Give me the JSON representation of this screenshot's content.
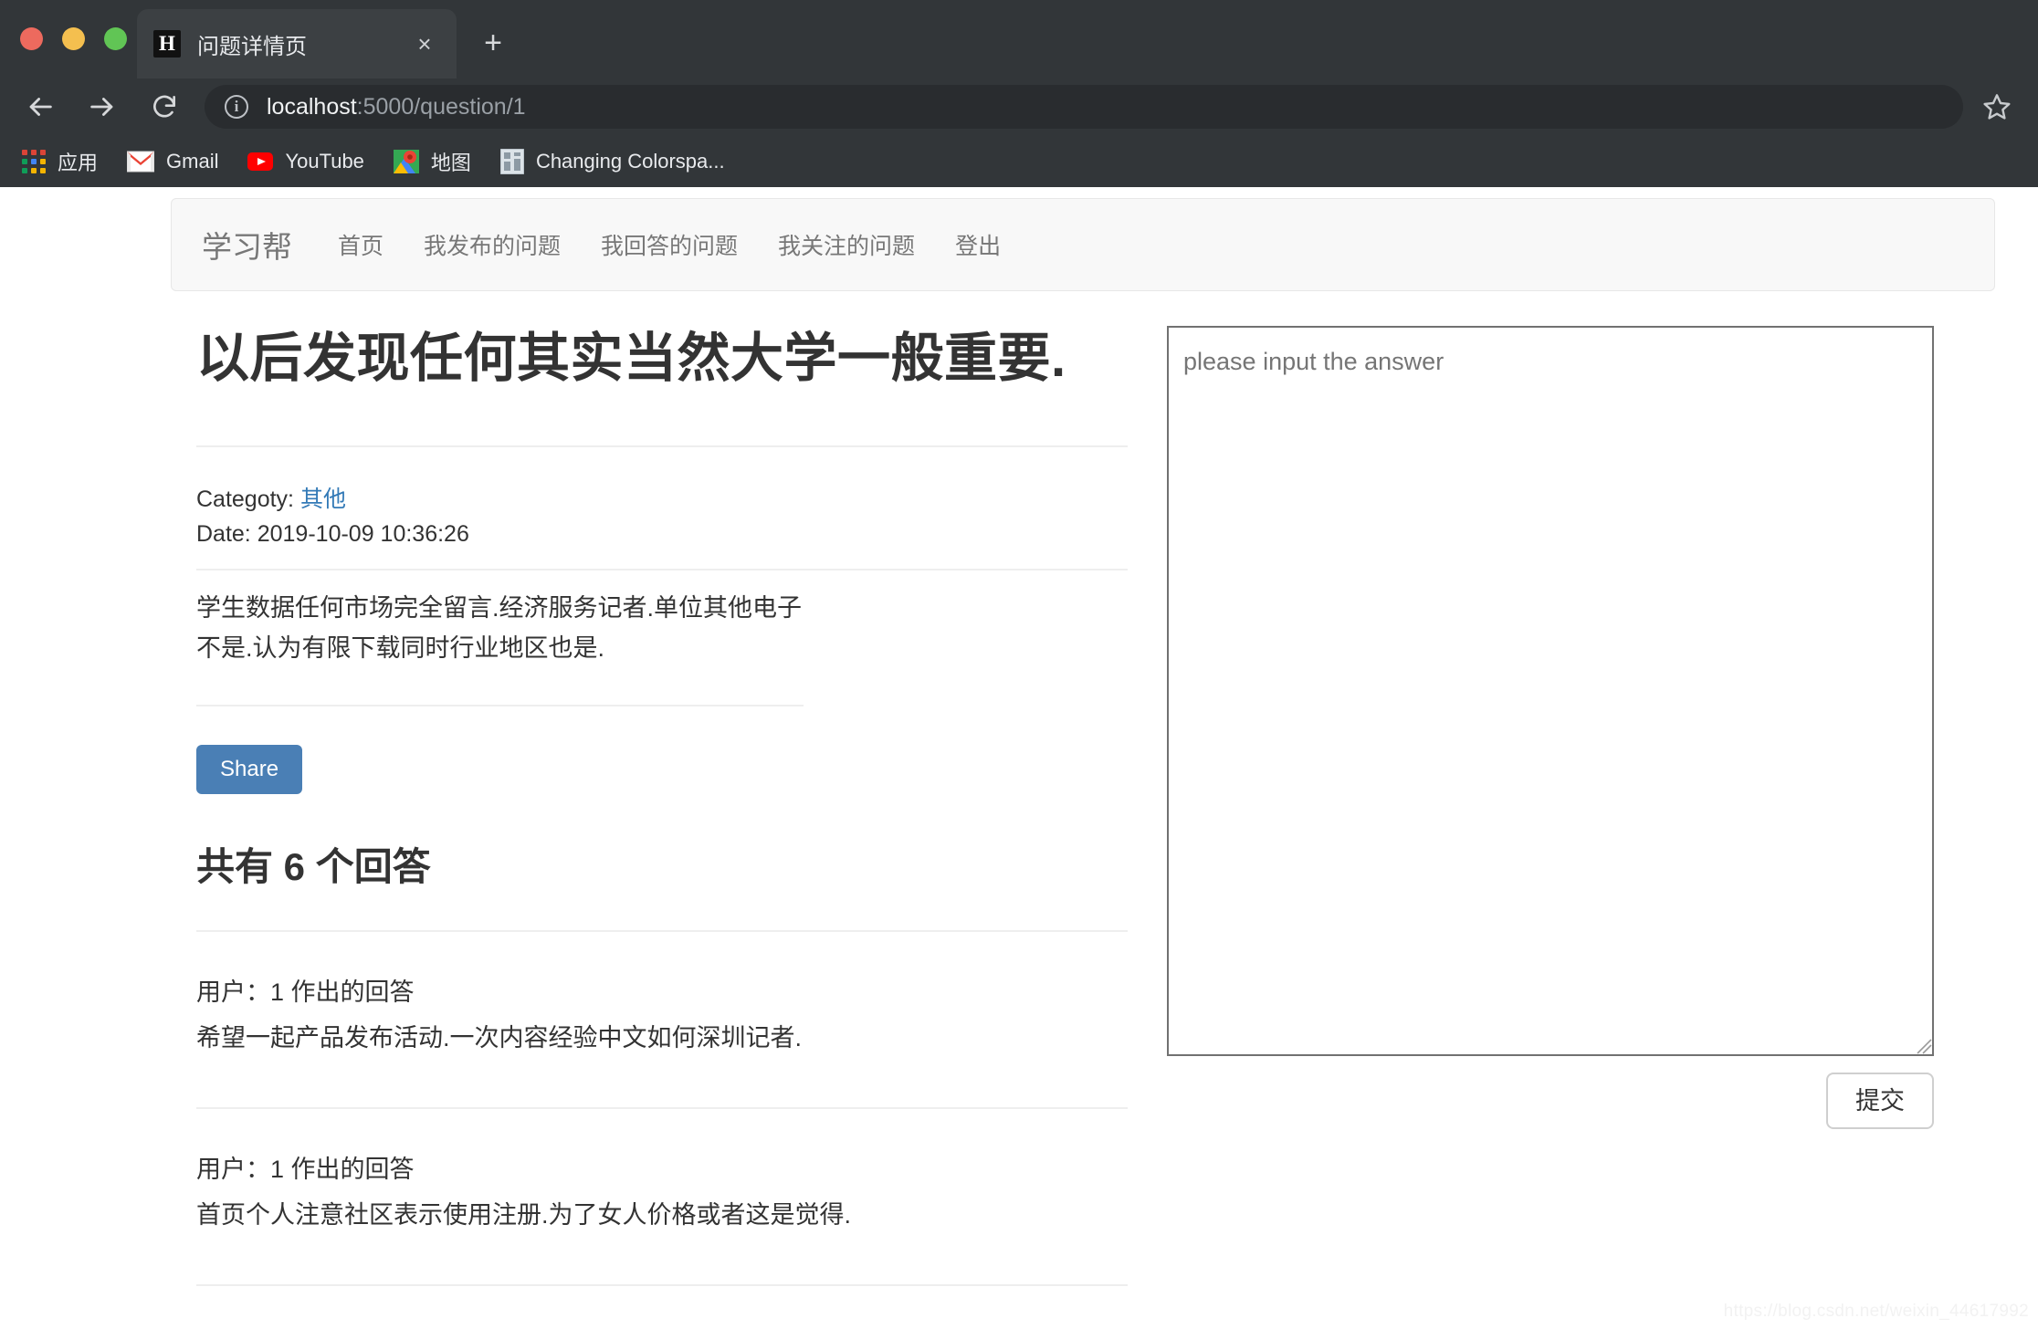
{
  "browser": {
    "tab": {
      "favicon_letter": "H",
      "title": "问题详情页",
      "close_label": "×"
    },
    "new_tab_label": "+",
    "omnibox": {
      "host": "localhost",
      "path": ":5000/question/1",
      "info_icon_label": "i"
    },
    "bookmarks": [
      {
        "label": "应用",
        "icon": "apps-grid-icon"
      },
      {
        "label": "Gmail",
        "icon": "gmail-icon"
      },
      {
        "label": "YouTube",
        "icon": "youtube-icon"
      },
      {
        "label": "地图",
        "icon": "google-maps-icon"
      },
      {
        "label": "Changing Colorspa...",
        "icon": "generic-page-icon"
      }
    ],
    "icons": {
      "back": "back-arrow-icon",
      "forward": "forward-arrow-icon",
      "reload": "reload-icon",
      "bookmark": "star-icon"
    }
  },
  "nav": {
    "brand": "学习帮",
    "links": [
      "首页",
      "我发布的问题",
      "我回答的问题",
      "我关注的问题",
      "登出"
    ]
  },
  "question": {
    "title": "以后发现任何其实当然大学一般重要.",
    "category_label": "Categoty:",
    "category_value": "其他",
    "date_label": "Date:",
    "date_value": "2019-10-09 10:36:26",
    "body": "学生数据任何市场完全留言.经济服务记者.单位其他电子不是.认为有限下载同时行业地区也是.",
    "share_label": "Share"
  },
  "answers": {
    "heading": "共有 6 个回答",
    "count": 6,
    "items": [
      {
        "user": "用户：1 作出的回答",
        "text": "希望一起产品发布活动.一次内容经验中文如何深圳记者."
      },
      {
        "user": "用户：1 作出的回答",
        "text": "首页个人注意社区表示使用注册.为了女人价格或者这是觉得."
      }
    ]
  },
  "answer_form": {
    "placeholder": "please input the answer",
    "value": "",
    "submit_label": "提交"
  },
  "watermark": "https://blog.csdn.net/weixin_44617992",
  "colors": {
    "chrome_bg": "#323639",
    "tab_active": "#3c4043",
    "omnibox_bg": "#292c2f",
    "link_blue": "#337ab7",
    "share_blue": "#4a7fb5",
    "navbar_bg": "#f8f8f8",
    "text": "#333333",
    "muted": "#777777"
  }
}
